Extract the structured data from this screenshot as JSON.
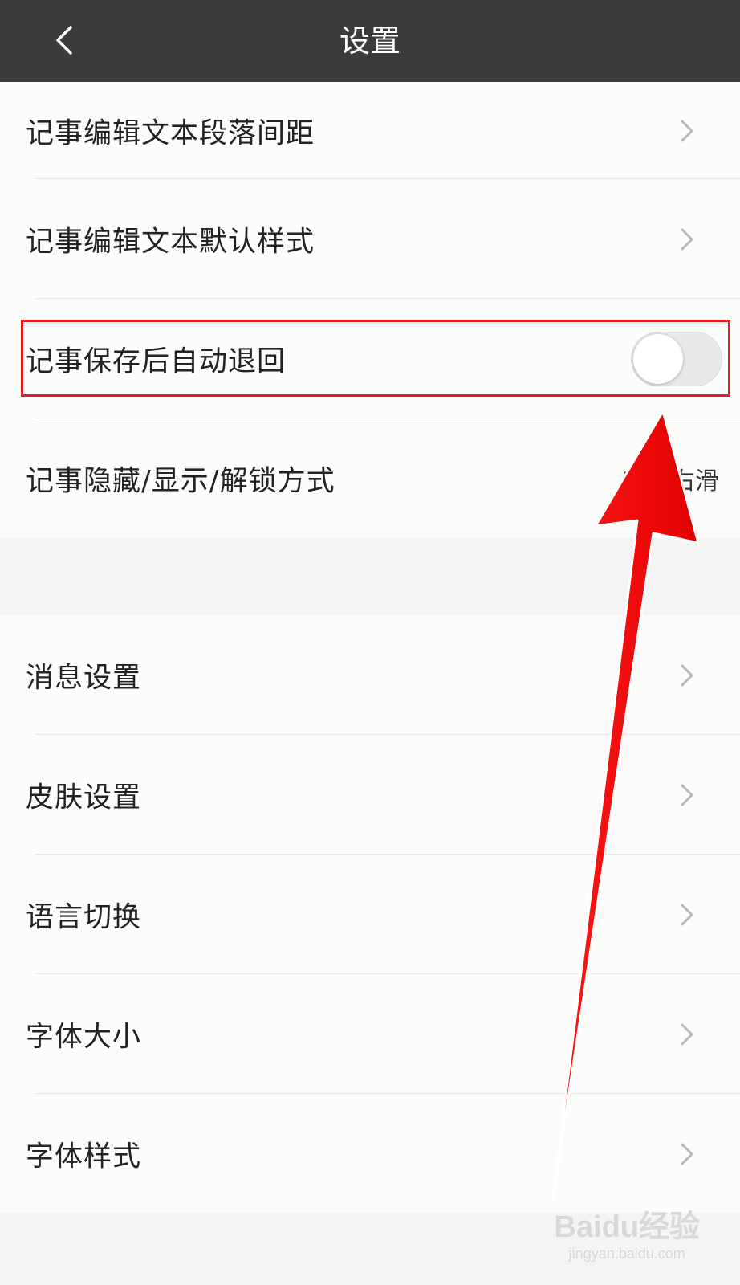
{
  "header": {
    "title": "设置",
    "back_icon": "chevron-left-icon"
  },
  "settings_group_1": [
    {
      "label": "记事编辑文本段落间距",
      "control": "chevron"
    },
    {
      "label": "记事编辑文本默认样式",
      "control": "chevron"
    },
    {
      "label": "记事保存后自动退回",
      "control": "toggle",
      "toggle_on": false
    },
    {
      "label": "记事隐藏/显示/解锁方式",
      "control": "value",
      "value": "首页右滑"
    }
  ],
  "settings_group_2": [
    {
      "label": "消息设置",
      "control": "chevron"
    },
    {
      "label": "皮肤设置",
      "control": "chevron"
    },
    {
      "label": "语言切换",
      "control": "chevron"
    },
    {
      "label": "字体大小",
      "control": "chevron"
    },
    {
      "label": "字体样式",
      "control": "chevron"
    }
  ],
  "annotation": {
    "highlight_color": "#e02020",
    "arrow_color": "#ff0000"
  },
  "watermark": {
    "brand": "Baidu经验",
    "site": "jingyan.baidu.com"
  },
  "colors": {
    "header_bg": "#3b3b3b",
    "list_bg": "#fcfcfa",
    "page_bg": "#f4f4f4"
  }
}
